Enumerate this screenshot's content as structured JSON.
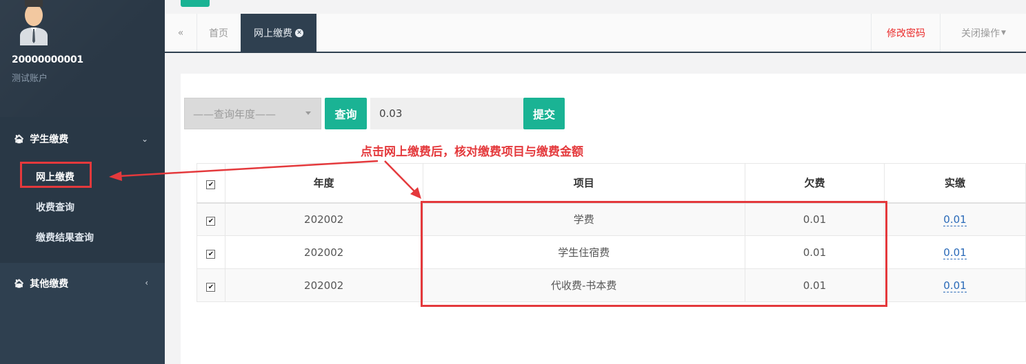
{
  "sidebar": {
    "user_id": "20000000001",
    "user_name": "测试账户",
    "groups": [
      {
        "label": "学生缴费",
        "icon": "home-icon",
        "expanded": true,
        "items": [
          {
            "label": "网上缴费",
            "active": true
          },
          {
            "label": "收费查询",
            "active": false
          },
          {
            "label": "缴费结果查询",
            "active": false
          }
        ]
      },
      {
        "label": "其他缴费",
        "icon": "home-icon",
        "expanded": false,
        "items": []
      }
    ]
  },
  "tabs": {
    "home": "首页",
    "active": "网上缴费",
    "change_password": "修改密码",
    "close_ops": "关闭操作"
  },
  "toolbar": {
    "year_placeholder": "——查询年度——",
    "query_label": "查询",
    "amount_value": "0.03",
    "submit_label": "提交"
  },
  "annotation": "点击网上缴费后，核对缴费项目与缴费金额",
  "table": {
    "headers": [
      "年度",
      "项目",
      "欠费",
      "实缴"
    ],
    "rows": [
      {
        "year": "202002",
        "item": "学费",
        "owed": "0.01",
        "paid": "0.01",
        "checked": true
      },
      {
        "year": "202002",
        "item": "学生住宿费",
        "owed": "0.01",
        "paid": "0.01",
        "checked": true
      },
      {
        "year": "202002",
        "item": "代收费-书本费",
        "owed": "0.01",
        "paid": "0.01",
        "checked": true
      }
    ]
  },
  "colors": {
    "sidebar": "#2f4050",
    "accent_green": "#1ab394",
    "annotation_red": "#e4393c",
    "link_blue": "#2a6ab8"
  }
}
